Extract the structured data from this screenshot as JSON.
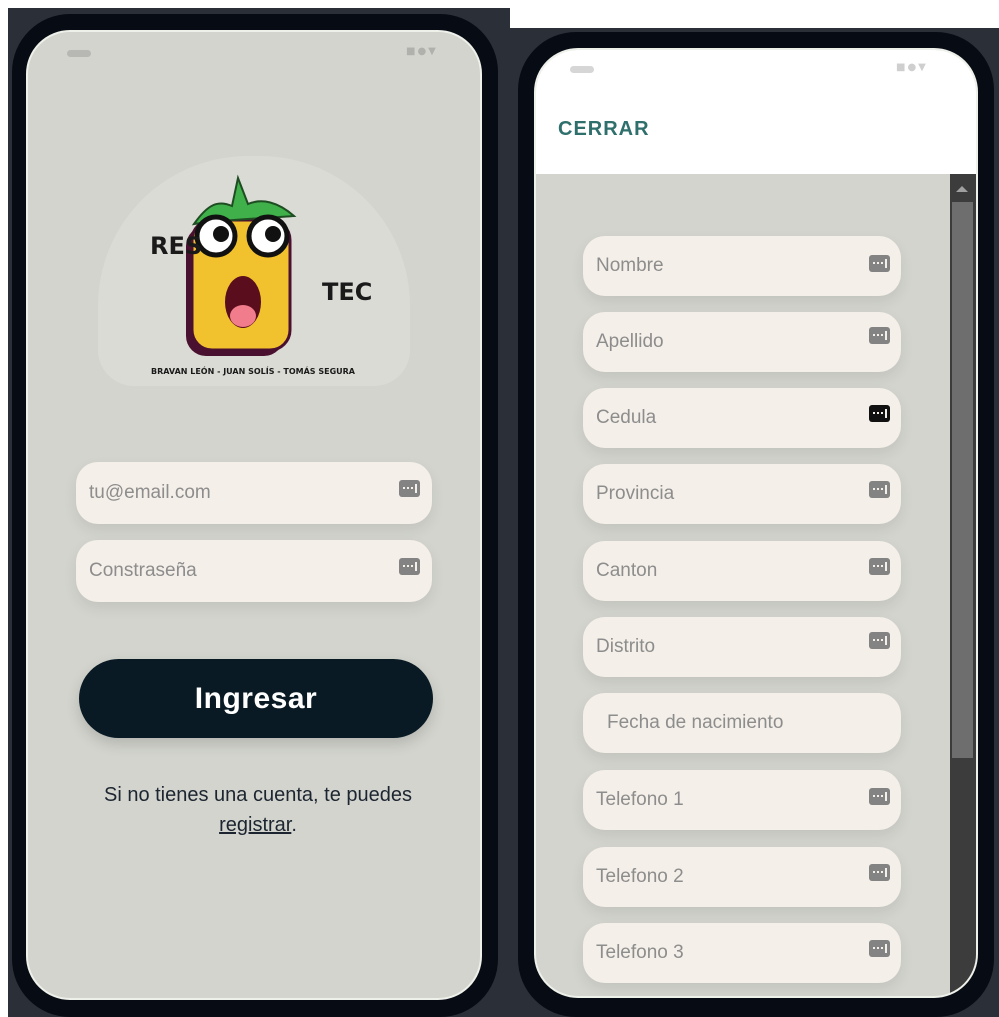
{
  "login_screen": {
    "logo": {
      "word_left": "RES",
      "word_right": "TEC",
      "credits": "BRAVAN LEÓN - JUAN SOLÍS - TOMÁS SEGURA"
    },
    "email_placeholder": "tu@email.com",
    "password_placeholder": "Constraseña",
    "submit_label": "Ingresar",
    "register_prefix": "Si no tienes una cuenta, te puedes",
    "register_link": "registrar",
    "register_suffix": "."
  },
  "register_screen": {
    "close_label": "CERRAR",
    "fields": [
      {
        "placeholder": "Nombre",
        "icon": "keyboard-icon"
      },
      {
        "placeholder": "Apellido",
        "icon": "keyboard-icon"
      },
      {
        "placeholder": "Cedula",
        "icon": "keyboard-icon"
      },
      {
        "placeholder": "Provincia",
        "icon": "keyboard-icon"
      },
      {
        "placeholder": "Canton",
        "icon": "keyboard-icon"
      },
      {
        "placeholder": "Distrito",
        "icon": "keyboard-icon"
      },
      {
        "placeholder": "Fecha de nacimiento",
        "icon": ""
      },
      {
        "placeholder": "Telefono 1",
        "icon": "keyboard-icon"
      },
      {
        "placeholder": "Telefono 2",
        "icon": "keyboard-icon"
      },
      {
        "placeholder": "Telefono 3",
        "icon": "keyboard-icon"
      }
    ]
  },
  "colors": {
    "screen_bg": "#d3d4ce",
    "field_bg": "#f4efe8",
    "button_bg": "#0a1a24",
    "accent": "#2f6f6c"
  }
}
